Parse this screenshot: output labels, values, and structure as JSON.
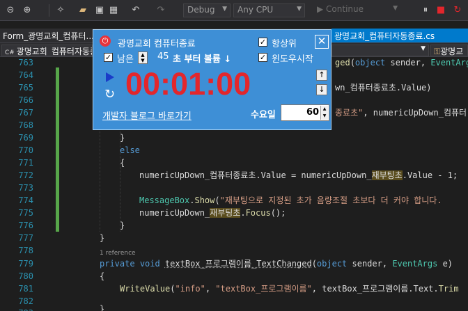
{
  "toolbar": {
    "config": "Debug",
    "platform": "Any CPU",
    "continue_label": "Continue"
  },
  "tabs": {
    "left_tab": "Form_광명교회_컴퓨터...",
    "active_tab": "광명교회_컴퓨터자동종료.cs",
    "nav_left": "광명교회_컴퓨터자동종",
    "nav_right": "광명교"
  },
  "popup": {
    "title": "광명교회 컴퓨터종료",
    "always_on_top": "항상위",
    "remaining_label": "남은",
    "seconds_value": "45",
    "volume_label": "초 부터 볼륨 ↓",
    "window_start": "윈도우시작",
    "timer": "00:01:00",
    "blog_link": "개발자 블로그 바로가기",
    "quantity_label": "수요일",
    "quantity_value": "60"
  },
  "editor": {
    "reference_label": "1 reference",
    "lines": [
      {
        "n": "763",
        "code": "ged(object sender, EventArgs e"
      },
      {
        "n": "764",
        "code": ""
      },
      {
        "n": "765",
        "code": "wn_컴퓨터종료초.Value)"
      },
      {
        "n": "766",
        "code": ""
      },
      {
        "n": "767",
        "code": "종료초\", numericUpDown_컴퓨터"
      },
      {
        "n": "768",
        "code": ""
      },
      {
        "n": "769",
        "code": "}"
      },
      {
        "n": "770",
        "code": "else"
      },
      {
        "n": "771",
        "code": "{"
      },
      {
        "n": "772",
        "code": "numericUpDown_컴퓨터종료초.Value = numericUpDown_재부팅초.Value - 1;"
      },
      {
        "n": "773",
        "code": ""
      },
      {
        "n": "774",
        "code": "MessageBox.Show(\"재부팅으로 지정된 초가 음량조절 초보다 더 커야 합니다."
      },
      {
        "n": "775",
        "code": "numericUpDown_재부팅초.Focus();"
      },
      {
        "n": "776",
        "code": "}"
      },
      {
        "n": "777",
        "code": "}"
      },
      {
        "n": "778",
        "code": ""
      },
      {
        "n": "779",
        "code": "private void textBox_프로그램이름_TextChanged(object sender, EventArgs e)"
      },
      {
        "n": "780",
        "code": "{"
      },
      {
        "n": "781",
        "code": "WriteValue(\"info\", \"textBox_프로그램이름\", textBox_프로그램이름.Text.Trim"
      },
      {
        "n": "782",
        "code": ""
      },
      {
        "n": "783",
        "code": "}"
      }
    ]
  }
}
